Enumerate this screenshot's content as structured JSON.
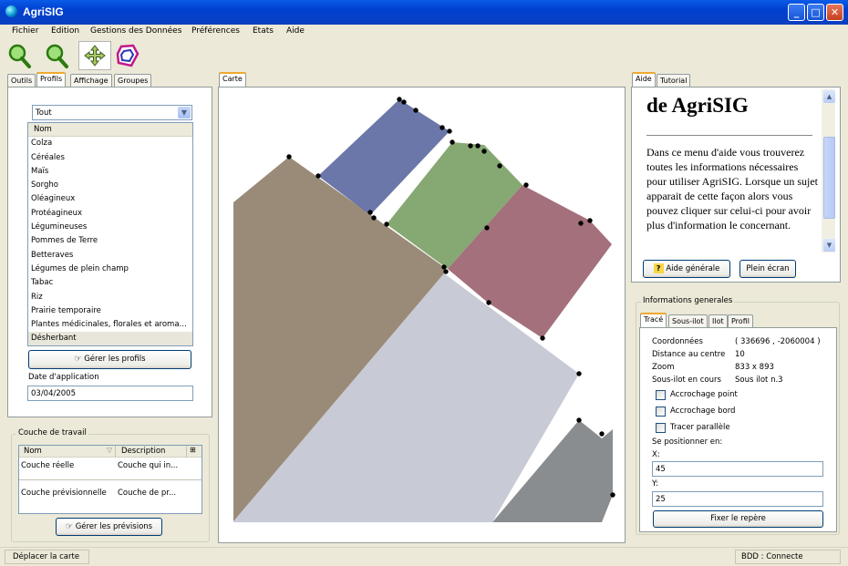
{
  "window": {
    "title": "AgriSIG",
    "minimize": "_",
    "maximize": "□",
    "close": "✕"
  },
  "menu": [
    "Fichier",
    "Edition",
    "Gestions des Données",
    "Préférences",
    "Etats",
    "Aide"
  ],
  "toolbar": {
    "tools": [
      "zoom-in-tool",
      "zoom-out-tool",
      "pan-tool",
      "select-region-tool"
    ]
  },
  "left_tabs": [
    "Outils",
    "Profils",
    "Affichage",
    "Groupes"
  ],
  "profils": {
    "dropdown_value": "Tout",
    "list_header": "Nom",
    "items": [
      "Colza",
      "Céréales",
      "Maïs",
      "Sorgho",
      "Oléagineux",
      "Protéagineux",
      "Légumineuses",
      "Pommes de Terre",
      "Betteraves",
      "Légumes de plein champ",
      "Tabac",
      "Riz",
      "Prairie temporaire",
      "Plantes médicinales, florales et aroma...",
      "Désherbant"
    ],
    "manage_button": "Gérer les profils",
    "date_label": "Date d'application",
    "date_value": "03/04/2005"
  },
  "couche": {
    "title": "Couche de travail",
    "col_name": "Nom",
    "col_desc": "Description",
    "rows": [
      {
        "name": "Couche réelle",
        "desc": "Couche qui in..."
      },
      {
        "name": "Couche prévisionnelle",
        "desc": "Couche de pr..."
      }
    ],
    "manage_button": "Gérer les prévisions"
  },
  "map": {
    "tab": "Carte",
    "colors": {
      "blue": "#6b77a8",
      "green": "#86a873",
      "red": "#a4707c",
      "brown": "#9a8b78",
      "lavender": "#c8cad6",
      "gray": "#8a8d90"
    }
  },
  "help": {
    "tabs": [
      "Aide",
      "Tutorial"
    ],
    "heading": "de AgriSIG",
    "text": "Dans ce menu d'aide vous trouverez toutes les informations nécessaires pour utiliser AgriSIG. Lorsque un sujet apparait de cette façon alors vous pouvez cliquer sur celui-ci pour avoir plus d'information le concernant.",
    "general_button": "Aide générale",
    "fullscreen_button": "Plein écran"
  },
  "info": {
    "title": "Informations generales",
    "tabs": [
      "Tracé",
      "Sous-ilot",
      "Ilot",
      "Profil"
    ],
    "coord_label": "Coordonnées",
    "coord_value": "( 336696 , -2060004 )",
    "distance_label": "Distance au centre",
    "distance_value": "10",
    "zoom_label": "Zoom",
    "zoom_value": "833 x 893",
    "sousilot_label": "Sous-ilot en cours",
    "sousilot_value": "Sous ilot n.3",
    "check_point": "Accrochage point",
    "check_bord": "Accrochage bord",
    "check_parallele": "Tracer parallèle",
    "position_label": "Se positionner en:",
    "x_label": "X:",
    "x_value": "45",
    "y_label": "Y:",
    "y_value": "25",
    "fix_button": "Fixer le repère"
  },
  "status": {
    "left": "Déplacer la carte",
    "right": "BDD : Connecte"
  }
}
